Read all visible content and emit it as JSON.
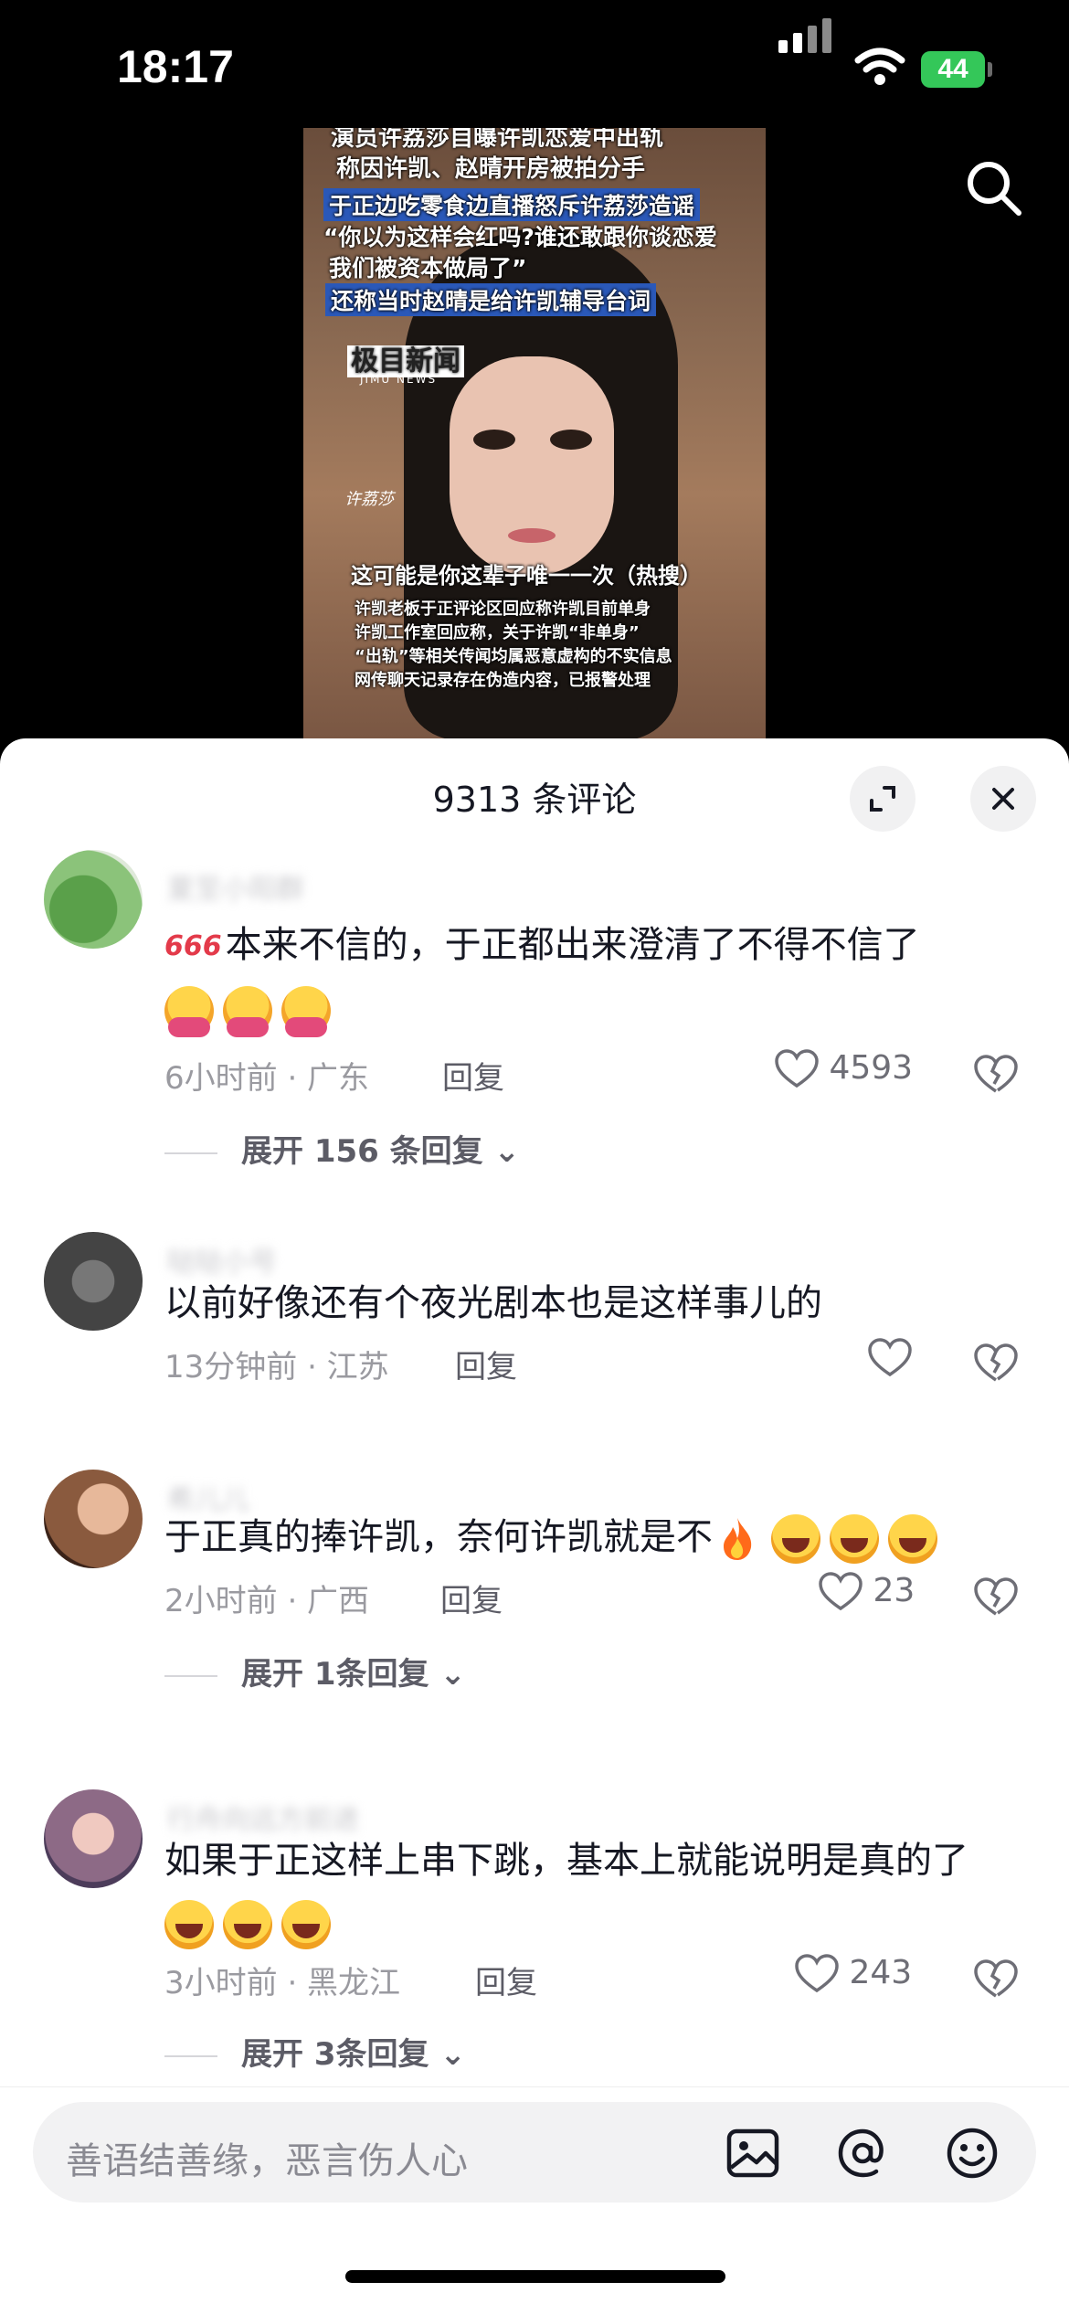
{
  "status_bar": {
    "time": "18:17",
    "battery": "44"
  },
  "video": {
    "captions": [
      "演员许荔莎自曝许凯恋爱中出轨",
      "称因许凯、赵晴开房被拍分手",
      "于正边吃零食边直播怒斥许荔莎造谣",
      "“你以为这样会红吗?谁还敢跟你谈恋爱",
      "我们被资本做局了”",
      "还称当时赵晴是给许凯辅导台词"
    ],
    "logo": "极目新闻",
    "logo_sub": "JIMU NEWS",
    "name_tag": "许荔莎",
    "hot_caption": "这可能是你这辈子唯一一次（热搜）",
    "bottom_captions": [
      "许凯老板于正评论区回应称许凯目前单身",
      "许凯工作室回应称，关于许凯“非单身”",
      "“出轨”等相关传闻均属恶意虚构的不实信息",
      "网传聊天记录存在伪造内容，已报警处理"
    ]
  },
  "sheet": {
    "title": "9313 条评论"
  },
  "comments": [
    {
      "username": "夏至小阳群",
      "prefix": "666",
      "text": "本来不信的，于正都出来澄清了不得不信了",
      "emoji_count": 3,
      "time": "6小时前 · 广东",
      "reply": "回复",
      "likes": "4593",
      "expand": "展开 156 条回复"
    },
    {
      "username": "哒哒小号",
      "text": "以前好像还有个夜光剧本也是这样事儿的",
      "time": "13分钟前 · 江苏",
      "reply": "回复",
      "likes": ""
    },
    {
      "username": "希儿儿",
      "text": "于正真的捧许凯，奈何许凯就是不",
      "time": "2小时前 · 广西",
      "reply": "回复",
      "likes": "23",
      "expand": "展开 1条回复"
    },
    {
      "username": "行舟向远方前进",
      "text": "如果于正这样上串下跳，基本上就能说明是真的了",
      "time": "3小时前 · 黑龙江",
      "reply": "回复",
      "likes": "243",
      "expand": "展开 3条回复"
    }
  ],
  "input": {
    "placeholder": "善语结善缘，恶言伤人心"
  },
  "icons": {
    "search": "search-icon",
    "expand": "expand-icon",
    "close": "close-icon",
    "like": "heart-icon",
    "dislike": "broken-heart-icon",
    "image": "image-icon",
    "at": "at-icon",
    "emoji": "emoji-icon"
  }
}
